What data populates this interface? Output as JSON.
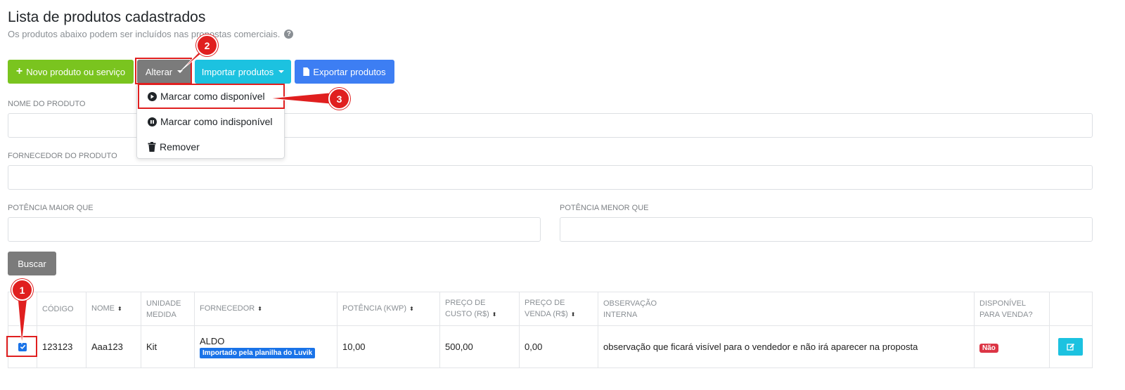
{
  "header": {
    "title": "Lista de produtos cadastrados",
    "subtitle": "Os produtos abaixo podem ser incluídos nas propostas comerciais."
  },
  "toolbar": {
    "new_label": "Novo produto ou serviço",
    "alter_label": "Alterar",
    "import_label": "Importar produtos",
    "export_label": "Exportar produtos"
  },
  "dropdown": {
    "items": [
      {
        "label": "Marcar como disponível",
        "icon": "play-icon"
      },
      {
        "label": "Marcar como indisponível",
        "icon": "pause-icon"
      },
      {
        "label": "Remover",
        "icon": "trash-icon"
      }
    ]
  },
  "filters": {
    "nome_label": "NOME DO PRODUTO",
    "fornecedor_label": "FORNECEDOR DO PRODUTO",
    "potencia_maior_label": "POTÊNCIA MAIOR QUE",
    "potencia_menor_label": "POTÊNCIA MENOR QUE",
    "search_label": "Buscar"
  },
  "table": {
    "headers": {
      "codigo": "CÓDIGO",
      "nome": "NOME",
      "unidade_1": "UNIDADE",
      "unidade_2": "MEDIDA",
      "fornecedor": "FORNECEDOR",
      "potencia": "POTÊNCIA (KWP)",
      "custo_1": "PREÇO DE",
      "custo_2": "CUSTO (R$)",
      "venda_1": "PREÇO DE",
      "venda_2": "VENDA (R$)",
      "obs_1": "OBSERVAÇÃO",
      "obs_2": "INTERNA",
      "disp_1": "DISPONÍVEL",
      "disp_2": "PARA VENDA?"
    },
    "rows": [
      {
        "checked": true,
        "codigo": "123123",
        "nome": "Aaa123",
        "unidade": "Kit",
        "fornecedor": "ALDO",
        "fornecedor_badge": "Importado pela planilha do Luvik",
        "potencia": "10,00",
        "custo": "500,00",
        "venda": "0,00",
        "observacao": "observação que ficará visível para o vendedor e não irá aparecer na proposta",
        "disponivel": "Não"
      }
    ]
  },
  "annotations": {
    "step1": "1",
    "step2": "2",
    "step3": "3",
    "color": "#e01f1f"
  },
  "colors": {
    "green": "#7ac41f",
    "gray": "#7b7b7b",
    "cyan": "#1cc2e0",
    "blue": "#3d7ef3"
  }
}
